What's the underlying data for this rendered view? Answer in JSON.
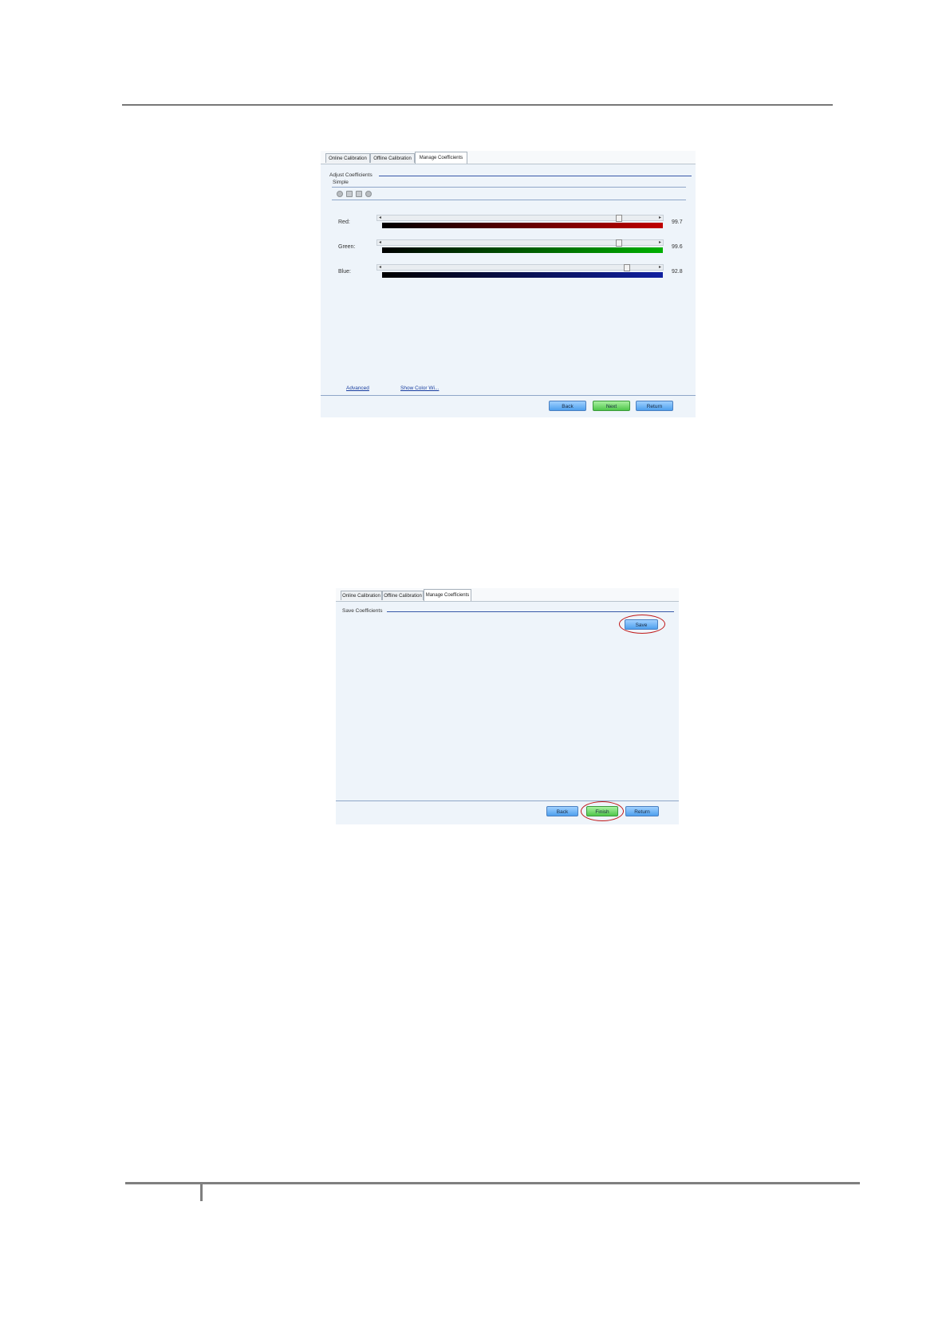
{
  "screenshot1": {
    "tabs": [
      "Online Calibration",
      "Offline Calibration",
      "Manage Coefficients"
    ],
    "group_title": "Adjust Coefficients",
    "mode_label": "Simple",
    "toolbar_icons": [
      "sun-icon",
      "sync-icon",
      "image-icon",
      "dot-icon"
    ],
    "sliders": [
      {
        "label": "Red:",
        "value_text": "99.7",
        "level_percent": 88,
        "color": "#c00000"
      },
      {
        "label": "Green:",
        "value_text": "99.6",
        "level_percent": 88,
        "color": "#00b000"
      },
      {
        "label": "Blue:",
        "value_text": "92.8",
        "level_percent": 91,
        "color": "#1020a0"
      }
    ],
    "links": [
      "Advanced",
      "Show Color Wi..."
    ],
    "buttons": {
      "back": "Back",
      "next": "Next",
      "return": "Return"
    }
  },
  "screenshot2": {
    "tabs": [
      "Online Calibration",
      "Offline Calibration",
      "Manage Coefficients"
    ],
    "group_title": "Save Coefficients",
    "buttons": {
      "save": "Save",
      "back": "Back",
      "finish": "Finish",
      "return": "Return"
    }
  }
}
